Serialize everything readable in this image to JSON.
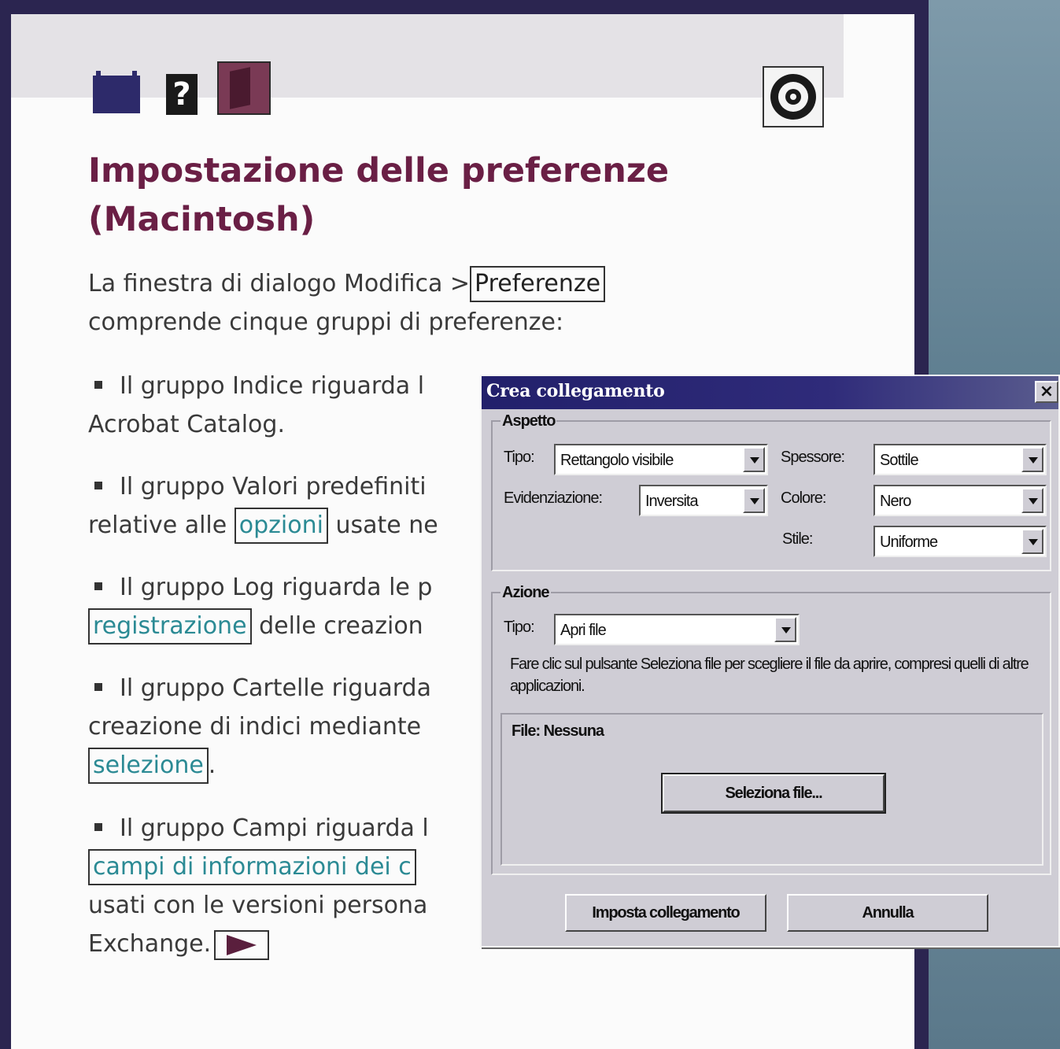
{
  "help_page": {
    "title_line1": "Impostazione delle preferenze",
    "title_line2": "(Macintosh)",
    "intro_part1": "La finestra di dialogo Modifica >",
    "intro_link": "Preferenze",
    "intro_part2": "comprende cinque gruppi di preferenze:",
    "bullets": [
      {
        "line1": "Il gruppo Indice riguarda l",
        "line2": "Acrobat Catalog."
      },
      {
        "line1": "Il gruppo Valori predefiniti",
        "line2_pre": "relative alle ",
        "link": "opzioni",
        "line2_post": " usate ne"
      },
      {
        "line1": "Il gruppo Log riguarda le p",
        "link": "registrazione",
        "line2_post": " delle creazion"
      },
      {
        "line1": "Il gruppo Cartelle riguarda",
        "line2": "creazione di indici mediante",
        "link": "selezione",
        "line3_post": "."
      },
      {
        "line1": "Il gruppo Campi riguarda l",
        "link": "campi di informazioni dei c",
        "line3": "usati con le versioni persona",
        "line4": "Exchange."
      }
    ]
  },
  "icons": {
    "book": "book-icon",
    "help": "help-icon",
    "exit": "exit-icon",
    "target": "target-icon",
    "next": "arrow-right-icon"
  },
  "dialog": {
    "title": "Crea collegamento",
    "close_label": "×",
    "aspetto": {
      "label": "Aspetto",
      "tipo_label": "Tipo:",
      "tipo_value": "Rettangolo visibile",
      "spessore_label": "Spessore:",
      "spessore_value": "Sottile",
      "evidenziazione_label": "Evidenziazione:",
      "evidenziazione_value": "Inversita",
      "colore_label": "Colore:",
      "colore_value": "Nero",
      "stile_label": "Stile:",
      "stile_value": "Uniforme"
    },
    "azione": {
      "label": "Azione",
      "tipo_label": "Tipo:",
      "tipo_value": "Apri file",
      "description": "Fare clic sul pulsante Seleziona file per scegliere il file da aprire, compresi quelli di altre applicazioni.",
      "file_label": "File: Nessuna",
      "select_file_button": "Seleziona file..."
    },
    "set_link_button": "Imposta collegamento",
    "cancel_button": "Annulla"
  }
}
